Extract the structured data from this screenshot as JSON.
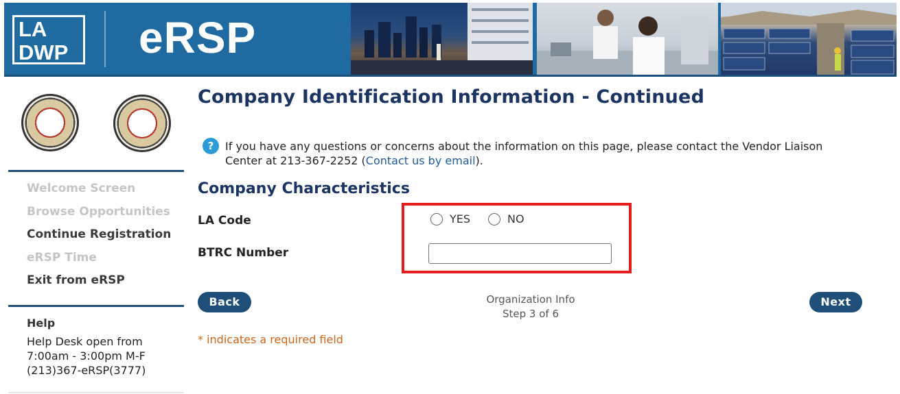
{
  "header": {
    "logo_line1": "LA",
    "logo_line2": "DWP",
    "app_title": "eRSP"
  },
  "sidebar": {
    "nav": [
      {
        "label": "Welcome Screen",
        "state": "disabled"
      },
      {
        "label": "Browse Opportunities",
        "state": "disabled"
      },
      {
        "label": "Continue Registration",
        "state": "active"
      },
      {
        "label": "eRSP Time",
        "state": "disabled"
      },
      {
        "label": "Exit from eRSP",
        "state": "active"
      }
    ],
    "help": {
      "title": "Help",
      "line1": "Help Desk open from",
      "line2": "7:00am - 3:00pm M-F",
      "line3": "(213)367-eRSP(3777)"
    }
  },
  "main": {
    "page_title": "Company Identification Information - Continued",
    "info": {
      "icon": "?",
      "text_before": "If you have any questions or concerns about the information on this page, please contact the Vendor Liaison Center at 213-367-2252 (",
      "link": "Contact us by email",
      "text_after": ")."
    },
    "section_title": "Company Characteristics",
    "la_code": {
      "label": "LA Code",
      "option_yes": "YES",
      "option_no": "NO",
      "selected": null
    },
    "btrc": {
      "label": "BTRC Number",
      "value": "",
      "placeholder": ""
    },
    "nav": {
      "back_label": "Back",
      "next_label": "Next",
      "step_name": "Organization Info",
      "step_text": "Step 3 of 6"
    },
    "required_note": "* indicates a required field"
  },
  "colors": {
    "banner_blue": "#1f6aa0",
    "title_navy": "#1b3461",
    "button_navy": "#1f4e79",
    "highlight_red": "#e41e1e",
    "required_orange": "#c9661c",
    "help_icon_blue": "#2c9bd6"
  }
}
